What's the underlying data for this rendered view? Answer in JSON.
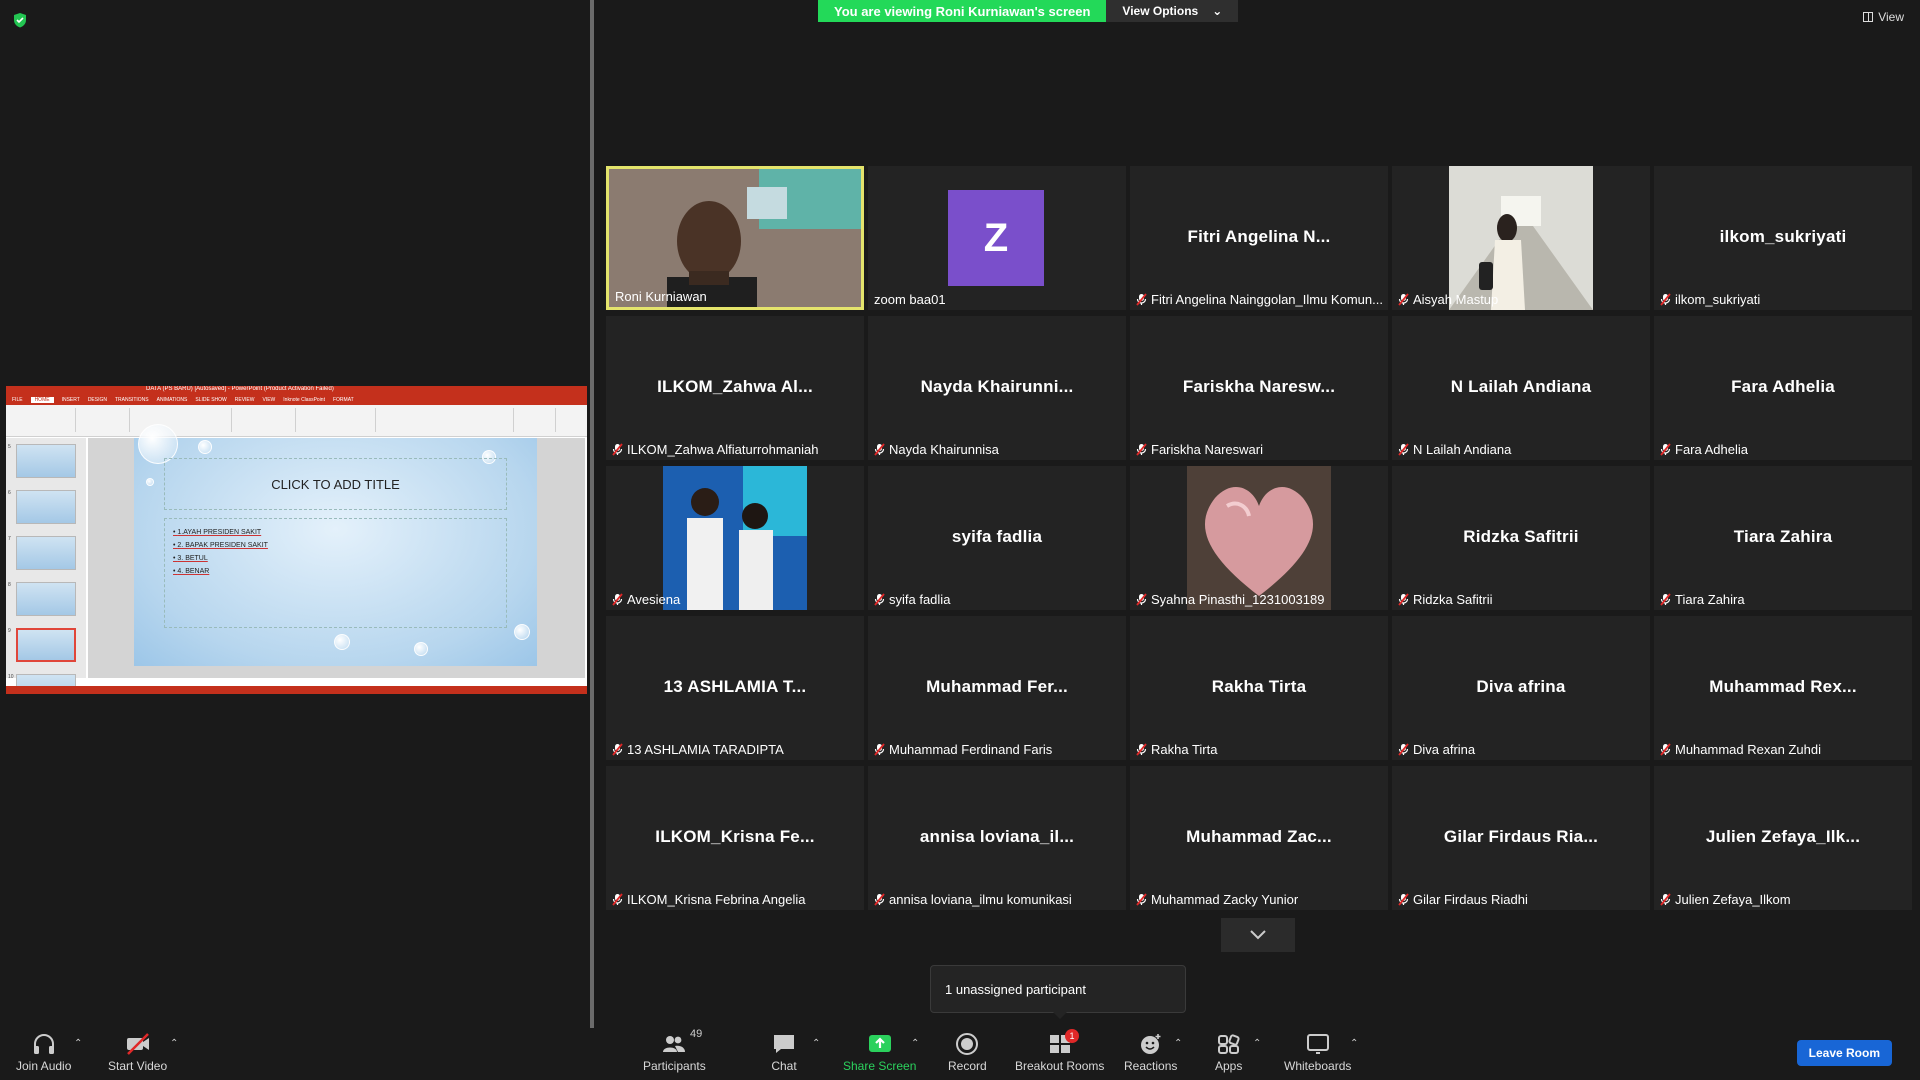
{
  "banner": {
    "viewing": "You are viewing Roni Kurniawan's screen",
    "view_options": "View Options",
    "view": "View"
  },
  "colors": {
    "banner_green": "#23d959",
    "active_border": "#e4e46c",
    "leave_blue": "#1866d6",
    "mute_red": "#e02828",
    "avatar_purple": "#7a4fcb"
  },
  "shared_screen": {
    "window_title": "DATA (PS BARU) [Autosaved] - PowerPoint (Product Activation Failed)",
    "tabs": [
      "FILE",
      "HOME",
      "INSERT",
      "DESIGN",
      "TRANSITIONS",
      "ANIMATIONS",
      "SLIDE SHOW",
      "REVIEW",
      "VIEW",
      "Inknote ClassPoint",
      "FORMAT"
    ],
    "slide_title": "CLICK TO ADD TITLE",
    "bullets": [
      "1.AYAH PRESIDEN SAKIT",
      "2. BAPAK PRESIDEN SAKIT",
      "3. BETUL",
      "4. BENAR"
    ],
    "thumbnail_numbers": [
      "5",
      "6",
      "7",
      "8",
      "9",
      "10"
    ]
  },
  "participants": [
    {
      "big": "",
      "label": "Roni Kurniawan",
      "muted": false,
      "kind": "video-active"
    },
    {
      "big": "",
      "label": "zoom baa01",
      "muted": false,
      "kind": "avatar",
      "initial": "Z"
    },
    {
      "big": "Fitri Angelina N...",
      "label": "Fitri Angelina Nainggolan_Ilmu Komun...",
      "muted": true
    },
    {
      "big": "",
      "label": "Aisyah Mastup",
      "muted": true,
      "kind": "photo-hall"
    },
    {
      "big": "ilkom_sukriyati",
      "label": "ilkom_sukriyati",
      "muted": true
    },
    {
      "big": "ILKOM_Zahwa Al...",
      "label": "ILKOM_Zahwa Alfiaturrohmaniah",
      "muted": true
    },
    {
      "big": "Nayda Khairunni...",
      "label": "Nayda Khairunnisa",
      "muted": true
    },
    {
      "big": "Fariskha Naresw...",
      "label": "Fariskha Nareswari",
      "muted": true
    },
    {
      "big": "N Lailah Andiana",
      "label": "N Lailah Andiana",
      "muted": true
    },
    {
      "big": "Fara Adhelia",
      "label": "Fara Adhelia",
      "muted": true
    },
    {
      "big": "",
      "label": "Avesiena",
      "muted": true,
      "kind": "photo-duo"
    },
    {
      "big": "syifa fadlia",
      "label": "syifa fadlia",
      "muted": true
    },
    {
      "big": "",
      "label": "Syahna Pinasthi_1231003189",
      "muted": true,
      "kind": "photo-heart"
    },
    {
      "big": "Ridzka Safitrii",
      "label": "Ridzka Safitrii",
      "muted": true
    },
    {
      "big": "Tiara Zahira",
      "label": "Tiara Zahira",
      "muted": true
    },
    {
      "big": "13 ASHLAMIA T...",
      "label": "13 ASHLAMIA TARADIPTA",
      "muted": true
    },
    {
      "big": "Muhammad Fer...",
      "label": "Muhammad Ferdinand Faris",
      "muted": true
    },
    {
      "big": "Rakha Tirta",
      "label": "Rakha Tirta",
      "muted": true
    },
    {
      "big": "Diva afrina",
      "label": "Diva afrina",
      "muted": true
    },
    {
      "big": "Muhammad Rex...",
      "label": "Muhammad Rexan Zuhdi",
      "muted": true
    },
    {
      "big": "ILKOM_Krisna Fe...",
      "label": "ILKOM_Krisna Febrina Angelia",
      "muted": true
    },
    {
      "big": "annisa loviana_il...",
      "label": "annisa loviana_ilmu komunikasi",
      "muted": true
    },
    {
      "big": "Muhammad Zac...",
      "label": "Muhammad Zacky Yunior",
      "muted": true
    },
    {
      "big": "Gilar Firdaus Ria...",
      "label": "Gilar Firdaus Riadhi",
      "muted": true
    },
    {
      "big": "Julien Zefaya_Ilk...",
      "label": "Julien Zefaya_Ilkom",
      "muted": true
    }
  ],
  "unassigned": "1 unassigned participant",
  "toolbar": {
    "join_audio": "Join Audio",
    "start_video": "Start Video",
    "participants": "Participants",
    "participants_count": "49",
    "chat": "Chat",
    "share_screen": "Share Screen",
    "record": "Record",
    "breakout_rooms": "Breakout Rooms",
    "breakout_badge": "1",
    "reactions": "Reactions",
    "apps": "Apps",
    "whiteboards": "Whiteboards",
    "leave": "Leave Room"
  }
}
